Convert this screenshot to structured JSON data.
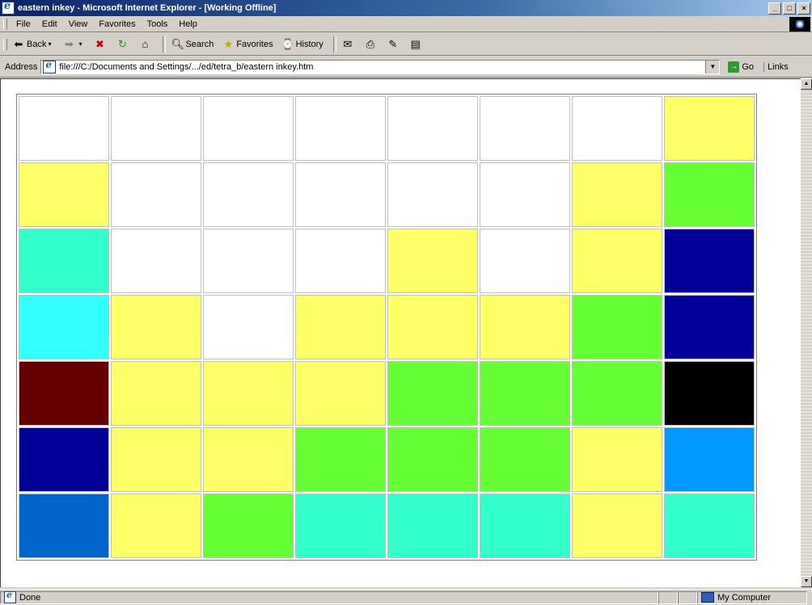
{
  "window": {
    "title": "eastern inkey - Microsoft Internet Explorer - [Working Offline]",
    "buttons": [
      "_",
      "□",
      "×"
    ]
  },
  "menu": [
    "File",
    "Edit",
    "View",
    "Favorites",
    "Tools",
    "Help"
  ],
  "toolbar": {
    "back": "Back",
    "search": "Search",
    "favorites": "Favorites",
    "history": "History"
  },
  "address": {
    "label": "Address",
    "url": "file:///C:/Documents and Settings/.../ed/tetra_b/eastern inkey.htm",
    "go": "Go",
    "links": "Links"
  },
  "grid": {
    "colors": {
      "white": "#ffffff",
      "yellow": "#ffff66",
      "green": "#66ff33",
      "teal": "#33ffcc",
      "navy": "#000099",
      "cyan": "#33ffff",
      "maroon": "#660000",
      "black": "#000000",
      "sky": "#0099ff",
      "blue": "#0066cc"
    },
    "rows": [
      [
        "white",
        "white",
        "white",
        "white",
        "white",
        "white",
        "white",
        "yellow"
      ],
      [
        "yellow",
        "white",
        "white",
        "white",
        "white",
        "white",
        "yellow",
        "green"
      ],
      [
        "teal",
        "white",
        "white",
        "white",
        "yellow",
        "white",
        "yellow",
        "navy"
      ],
      [
        "cyan",
        "yellow",
        "white",
        "yellow",
        "yellow",
        "yellow",
        "green",
        "navy"
      ],
      [
        "maroon",
        "yellow",
        "yellow",
        "yellow",
        "green",
        "green",
        "green",
        "black"
      ],
      [
        "navy",
        "yellow",
        "yellow",
        "green",
        "green",
        "green",
        "yellow",
        "sky"
      ],
      [
        "blue",
        "yellow",
        "green",
        "teal",
        "teal",
        "teal",
        "yellow",
        "teal"
      ]
    ]
  },
  "status": {
    "text": "Done",
    "zone": "My Computer"
  }
}
